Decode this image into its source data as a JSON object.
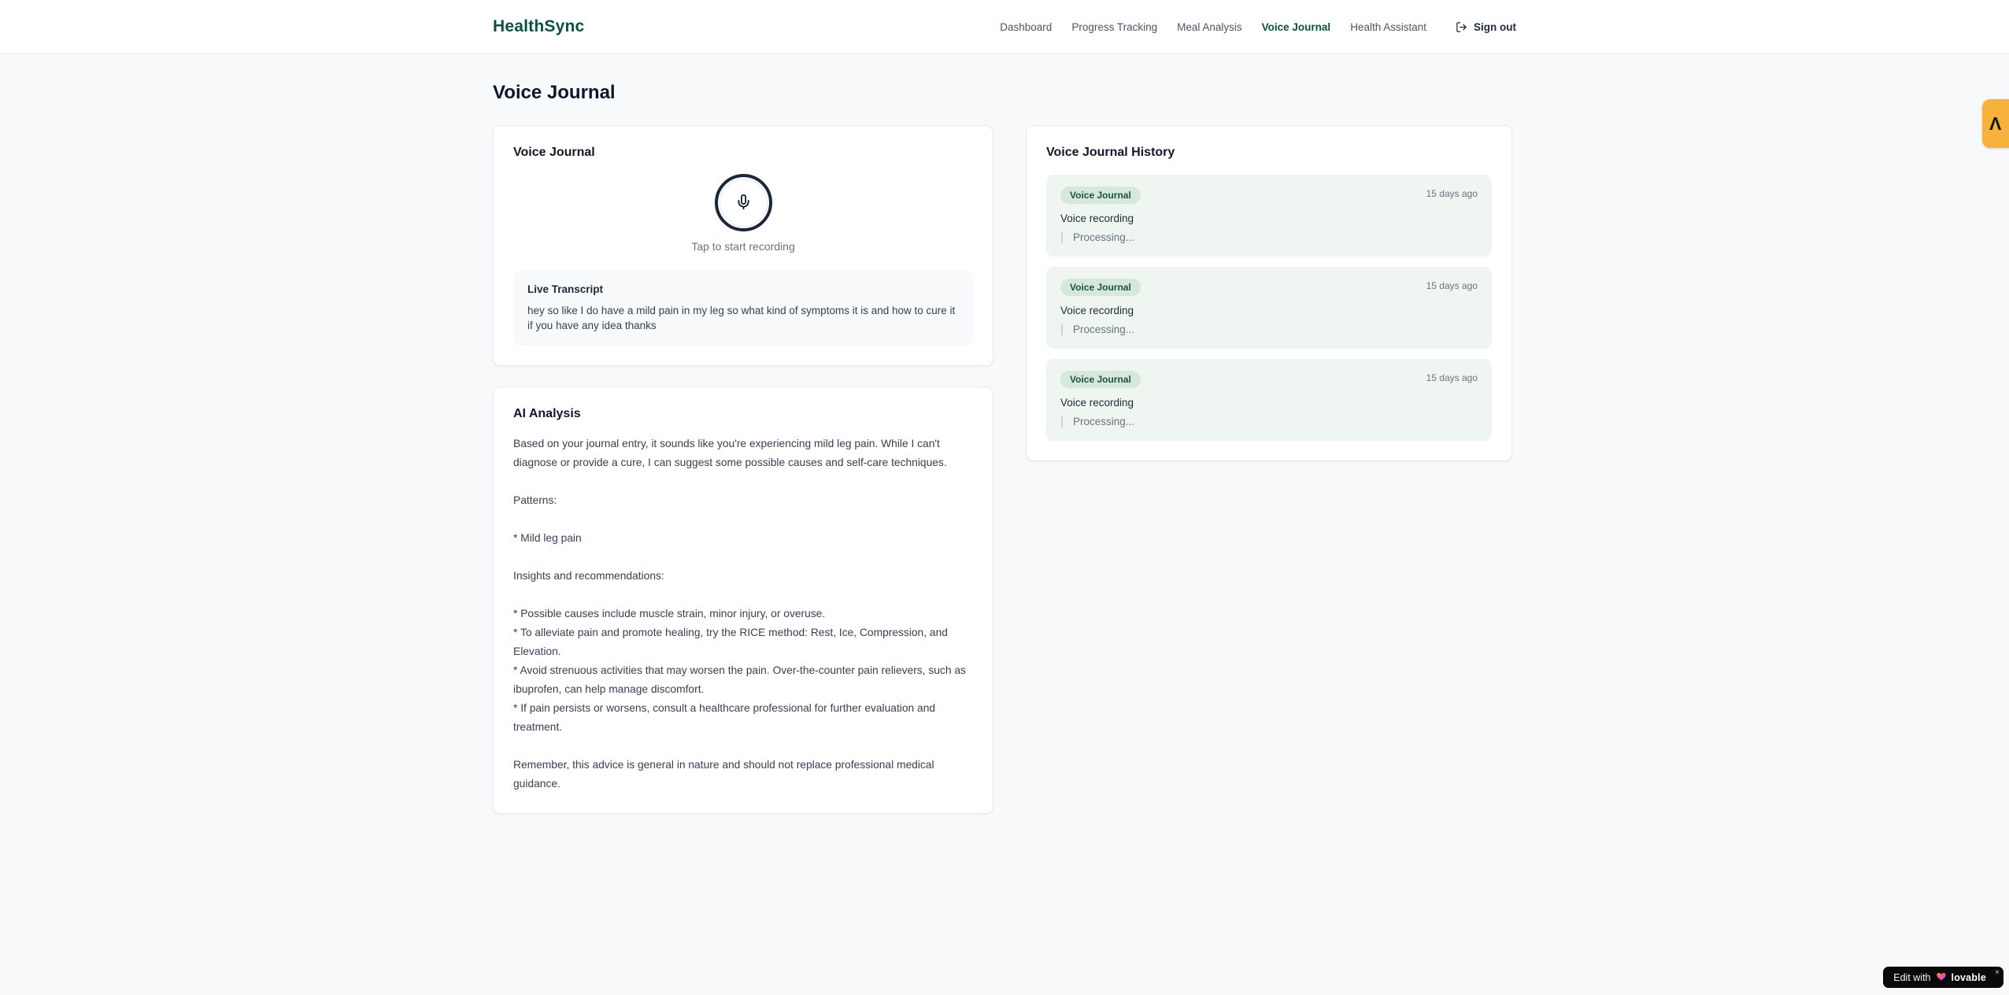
{
  "brand": {
    "name": "HealthSync"
  },
  "nav": {
    "items": [
      {
        "label": "Dashboard",
        "active": false
      },
      {
        "label": "Progress Tracking",
        "active": false
      },
      {
        "label": "Meal Analysis",
        "active": false
      },
      {
        "label": "Voice Journal",
        "active": true
      },
      {
        "label": "Health Assistant",
        "active": false
      }
    ],
    "sign_out_label": "Sign out"
  },
  "page": {
    "title": "Voice Journal"
  },
  "recorder_card": {
    "title": "Voice Journal",
    "tap_hint": "Tap to start recording",
    "transcript": {
      "title": "Live Transcript",
      "text": "hey so like I do have a mild pain in my leg so what kind of symptoms it is and how to cure it if you have any idea thanks"
    }
  },
  "analysis_card": {
    "title": "AI Analysis",
    "body": "Based on your journal entry, it sounds like you're experiencing mild leg pain. While I can't diagnose or provide a cure, I can suggest some possible causes and self-care techniques.\n\nPatterns:\n\n* Mild leg pain\n\nInsights and recommendations:\n\n* Possible causes include muscle strain, minor injury, or overuse.\n* To alleviate pain and promote healing, try the RICE method: Rest, Ice, Compression, and Elevation.\n* Avoid strenuous activities that may worsen the pain. Over-the-counter pain relievers, such as ibuprofen, can help manage discomfort.\n* If pain persists or worsens, consult a healthcare professional for further evaluation and treatment.\n\nRemember, this advice is general in nature and should not replace professional medical guidance."
  },
  "history_card": {
    "title": "Voice Journal History",
    "entries": [
      {
        "badge": "Voice Journal",
        "time": "15 days ago",
        "label": "Voice recording",
        "status": "Processing..."
      },
      {
        "badge": "Voice Journal",
        "time": "15 days ago",
        "label": "Voice recording",
        "status": "Processing..."
      },
      {
        "badge": "Voice Journal",
        "time": "15 days ago",
        "label": "Voice recording",
        "status": "Processing..."
      }
    ]
  },
  "overlays": {
    "edit_badge": {
      "prefix": "Edit with",
      "brand": "lovable",
      "close": "×"
    },
    "side_badge": {
      "glyph": "Λ"
    }
  },
  "colors": {
    "brand_green": "#0d4f42",
    "badge_pill_bg": "#d6e7dc",
    "badge_pill_text": "#1d5143",
    "entry_bg": "#eff6f1",
    "side_badge_bg": "#f6b23c",
    "mic_ring": "#1b2736"
  }
}
